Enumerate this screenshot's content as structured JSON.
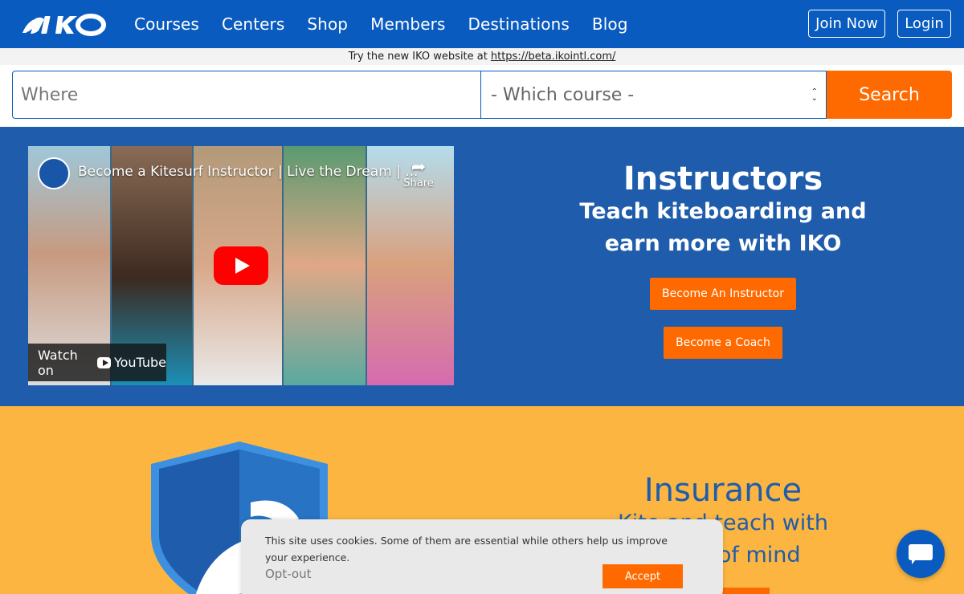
{
  "header": {
    "logo_alt": "IKO",
    "nav": [
      "Courses",
      "Centers",
      "Shop",
      "Members",
      "Destinations",
      "Blog"
    ],
    "join_label": "Join Now",
    "login_label": "Login"
  },
  "notice": {
    "text": "Try the new IKO website at",
    "link": "https://beta.ikointl.com/"
  },
  "search": {
    "where_placeholder": "Where",
    "course_selected": "- Which course -",
    "button_label": "Search"
  },
  "instructors": {
    "video_title": "Become a Kitesurf Instructor | Live the Dream | ...",
    "share_label": "Share",
    "watch_on": "Watch on",
    "youtube": "YouTube",
    "heading": "Instructors",
    "sub1": "Teach kiteboarding and",
    "sub2": "earn more with IKO",
    "btn_instructor": "Become An Instructor",
    "btn_coach": "Become a Coach"
  },
  "insurance": {
    "heading": "Insurance",
    "sub1": "Kite and teach with",
    "sub2": "peace of mind"
  },
  "cookie": {
    "text": "This site uses cookies. Some of them are essential while others help us improve your experience.",
    "optout": "Opt-out",
    "accept": "Accept"
  },
  "colors": {
    "brand_blue": "#0a5bbf",
    "section_blue": "#1f5dac",
    "accent_orange": "#ff6a00",
    "insurance_yellow": "#fbb540"
  }
}
